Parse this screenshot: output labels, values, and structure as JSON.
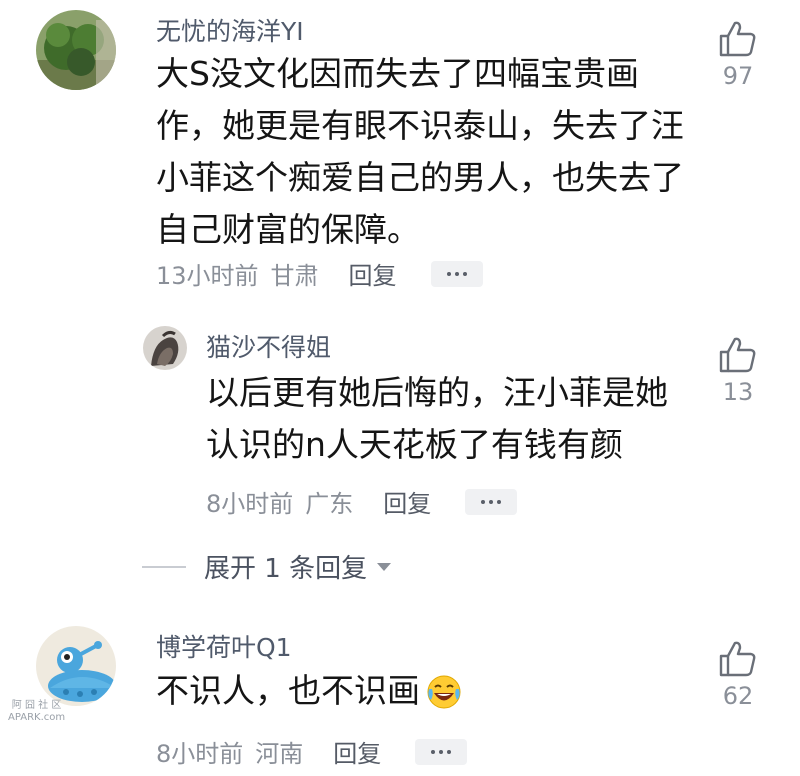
{
  "comments": [
    {
      "username": "无忧的海洋YI",
      "lines": [
        "大S没文化因而失去了四幅宝贵画",
        "作，她更是有眼不识泰山，失去了汪",
        "小菲这个痴爱自己的男人，也失去了",
        "自己财富的保障。"
      ],
      "time": "13小时前",
      "location": "甘肃",
      "reply_label": "回复",
      "likes": "97"
    },
    {
      "username": "猫沙不得姐",
      "lines": [
        "以后更有她后悔的，汪小菲是她",
        "认识的n人天花板了有钱有颜"
      ],
      "time": "8小时前",
      "location": "广东",
      "reply_label": "回复",
      "likes": "13"
    },
    {
      "username": "博学荷叶Q1",
      "lines": [
        "不识人，也不识画"
      ],
      "time": "8小时前",
      "location": "河南",
      "reply_label": "回复",
      "likes": "62"
    }
  ],
  "expand_replies_label": "展开 1 条回复",
  "emoji_icon": "laughing-crying-emoji",
  "watermark": [
    "阿 囧 社 区",
    "APARK.com"
  ],
  "colors": {
    "username": "#505a6b",
    "meta": "#8a8f98",
    "body": "#151515"
  }
}
